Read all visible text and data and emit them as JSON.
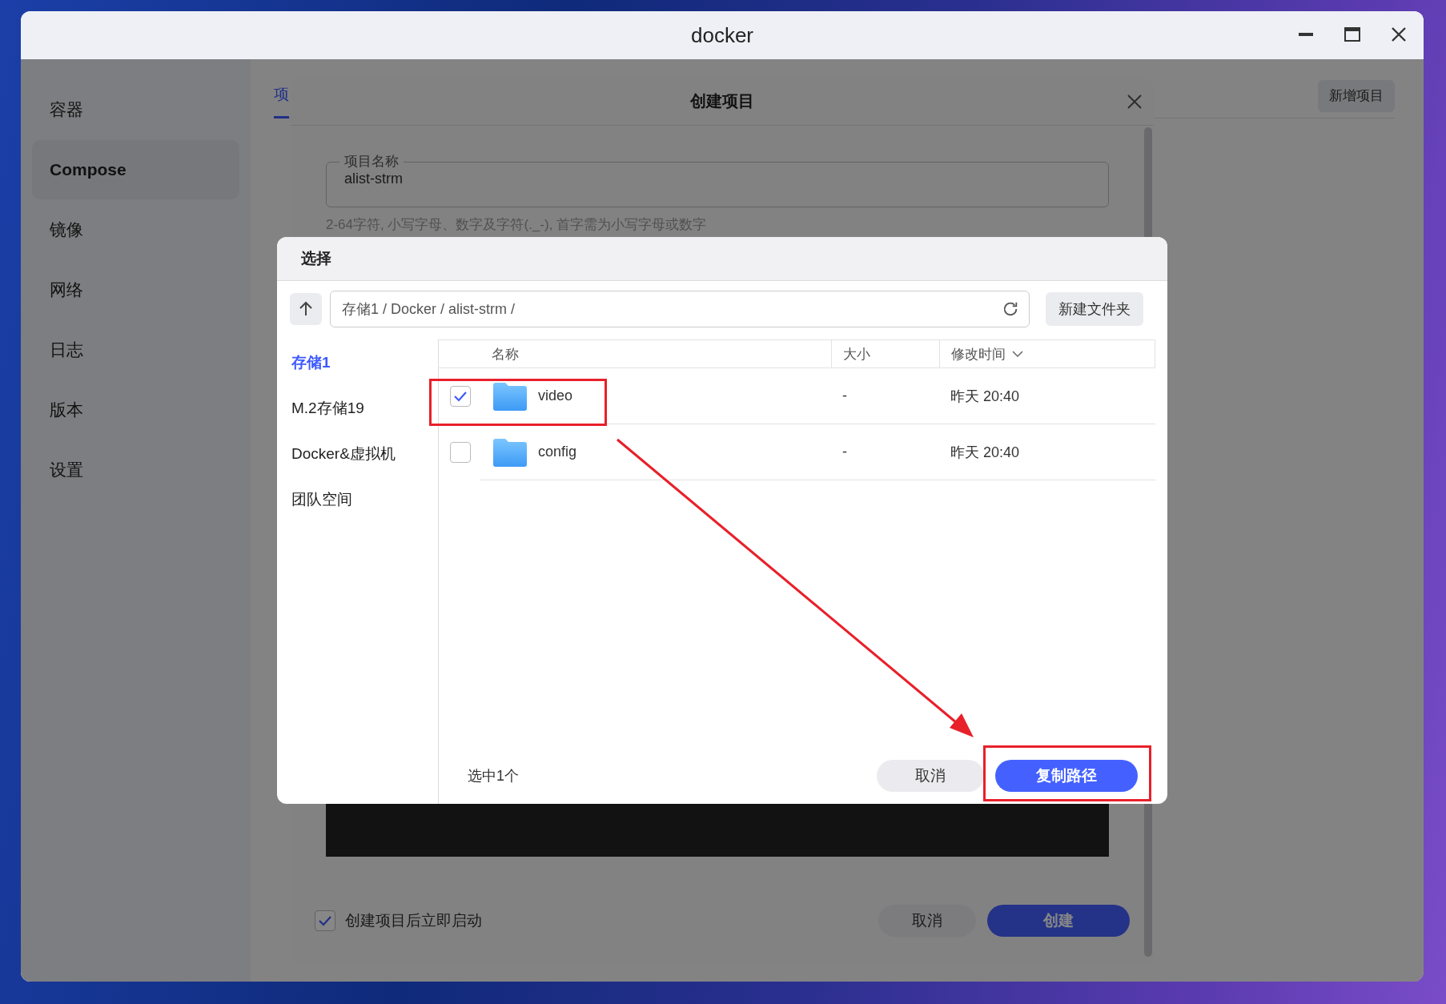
{
  "window": {
    "title": "docker"
  },
  "sidebar": {
    "items": [
      {
        "label": "容器",
        "selected": false
      },
      {
        "label": "Compose",
        "selected": true
      },
      {
        "label": "镜像",
        "selected": false
      },
      {
        "label": "网络",
        "selected": false
      },
      {
        "label": "日志",
        "selected": false
      },
      {
        "label": "版本",
        "selected": false
      },
      {
        "label": "设置",
        "selected": false
      }
    ]
  },
  "main": {
    "tabs": [
      {
        "label": "项",
        "selected": true
      }
    ],
    "add_button": "新增项目"
  },
  "create_dialog": {
    "title": "创建项目",
    "name_field": {
      "label": "项目名称",
      "value": "alist-strm"
    },
    "hint": "2-64字符, 小写字母、数字及字符(._-), 首字需为小写字母或数字",
    "auto_start": {
      "label": "创建项目后立即启动",
      "checked": true
    },
    "buttons": [
      {
        "label": "取消",
        "kind": "secondary"
      },
      {
        "label": "创建",
        "kind": "primary"
      }
    ]
  },
  "select_dialog": {
    "title": "选择",
    "path": "存储1 / Docker / alist-strm /",
    "new_folder_button": "新建文件夹",
    "locations": [
      {
        "label": "存储1",
        "selected": true
      },
      {
        "label": "M.2存储19",
        "selected": false
      },
      {
        "label": "Docker&虚拟机",
        "selected": false
      },
      {
        "label": "团队空间",
        "selected": false
      }
    ],
    "columns": [
      "名称",
      "大小",
      "修改时间"
    ],
    "files": [
      {
        "name": "video",
        "size": "-",
        "modified": "昨天 20:40",
        "checked": true
      },
      {
        "name": "config",
        "size": "-",
        "modified": "昨天 20:40",
        "checked": false
      }
    ],
    "selection_count": "选中1个",
    "buttons": [
      {
        "label": "取消",
        "kind": "secondary"
      },
      {
        "label": "复制路径",
        "kind": "primary"
      }
    ]
  }
}
